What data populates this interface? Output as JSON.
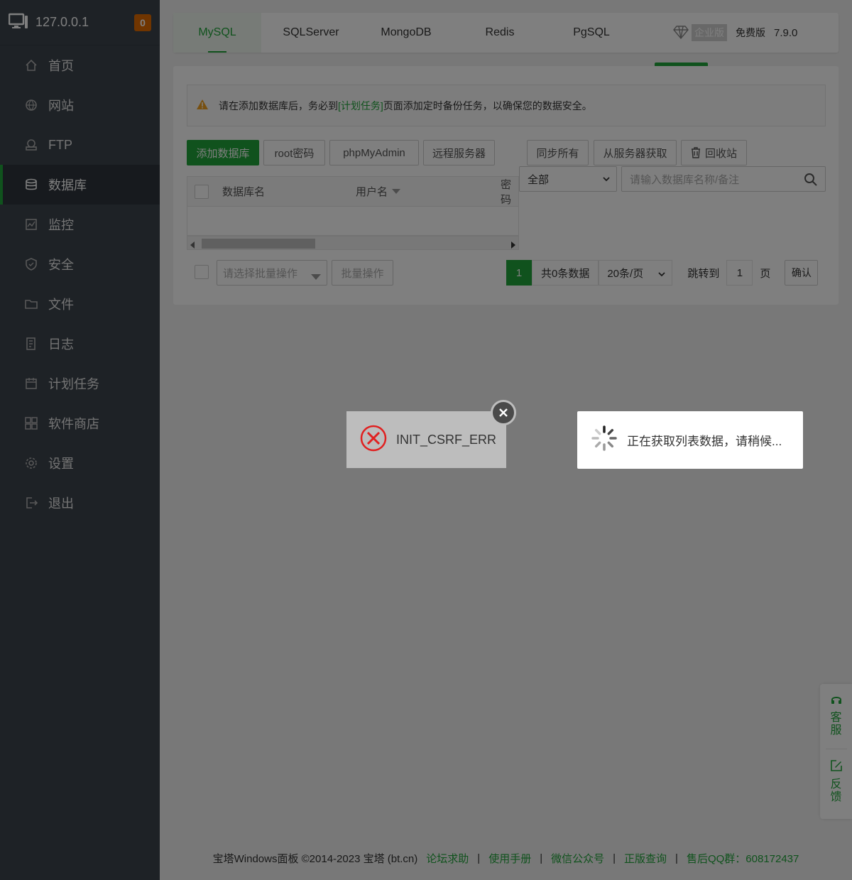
{
  "sidebar": {
    "ip": "127.0.0.1",
    "badge": "0",
    "items": [
      {
        "label": "首页",
        "icon": "home-icon"
      },
      {
        "label": "网站",
        "icon": "globe-icon"
      },
      {
        "label": "FTP",
        "icon": "ftp-icon"
      },
      {
        "label": "数据库",
        "icon": "database-icon",
        "active": true
      },
      {
        "label": "监控",
        "icon": "monitor-icon"
      },
      {
        "label": "安全",
        "icon": "shield-icon"
      },
      {
        "label": "文件",
        "icon": "folder-icon"
      },
      {
        "label": "日志",
        "icon": "log-icon"
      },
      {
        "label": "计划任务",
        "icon": "calendar-icon"
      },
      {
        "label": "软件商店",
        "icon": "apps-icon"
      },
      {
        "label": "设置",
        "icon": "gear-icon"
      },
      {
        "label": "退出",
        "icon": "logout-icon"
      }
    ]
  },
  "tabs": {
    "items": [
      "MySQL",
      "SQLServer",
      "MongoDB",
      "Redis",
      "PgSQL"
    ],
    "enterprise": "企业版",
    "free": "免费版",
    "version": "7.9.0"
  },
  "warning": {
    "before": "请在添加数据库后，务必到",
    "link": "[计划任务]",
    "after": "页面添加定时备份任务，以确保您的数据安全。"
  },
  "toolbar": {
    "add": "添加数据库",
    "root": "root密码",
    "pma": "phpMyAdmin",
    "remote": "远程服务器",
    "sync_all": "同步所有",
    "from_server": "从服务器获取",
    "recycle": "回收站",
    "filter_value": "全部",
    "search_placeholder": "请输入数据库名称/备注"
  },
  "table": {
    "columns": [
      "数据库名",
      "用户名",
      "密码"
    ]
  },
  "batch": {
    "placeholder": "请选择批量操作",
    "button": "批量操作"
  },
  "pager": {
    "current": "1",
    "total": "共0条数据",
    "per_page": "20条/页",
    "jump_to": "跳转到",
    "jump_value": "1",
    "page": "页",
    "confirm": "确认"
  },
  "dialogs": {
    "error": "INIT_CSRF_ERR",
    "loading": "正在获取列表数据，请稍候..."
  },
  "float": {
    "service": [
      "客",
      "服"
    ],
    "feedback": [
      "反",
      "馈"
    ]
  },
  "footer": {
    "copyright": "宝塔Windows面板 ©2014-2023 宝塔 (bt.cn)",
    "links": [
      "论坛求助",
      "使用手册",
      "微信公众号",
      "正版查询"
    ],
    "qq": "售后QQ群：608172437"
  },
  "colors": {
    "accent": "#20a53a",
    "sidebar": "#3c444d",
    "badge": "#e06a00",
    "error": "#e02020"
  }
}
